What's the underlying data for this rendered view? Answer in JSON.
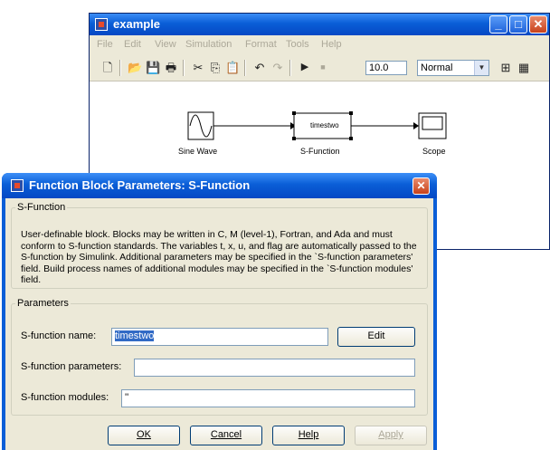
{
  "model_window": {
    "title": "example",
    "menu": [
      "File",
      "Edit",
      "View",
      "Simulation",
      "Format",
      "Tools",
      "Help"
    ],
    "stop_time": "10.0",
    "sim_mode": "Normal",
    "blocks": [
      {
        "name": "Sine Wave"
      },
      {
        "name": "S-Function",
        "content": "timestwo"
      },
      {
        "name": "Scope"
      }
    ]
  },
  "dialog": {
    "title": "Function Block Parameters: S-Function",
    "section_label": "S-Function",
    "description": "User-definable block.  Blocks may be written in C, M (level-1), Fortran, and Ada and must conform to S-function standards.  The variables t, x, u, and flag are automatically passed to the S-function by Simulink.  Additional parameters may be specified in the `S-function parameters' field. Build process names of additional modules may be specified in the `S-function modules' field.",
    "params_label": "Parameters",
    "name_label": "S-function name:",
    "name_value": "timestwo",
    "edit_label": "Edit",
    "params_field_label": "S-function parameters:",
    "params_value": "",
    "modules_label": "S-function modules:",
    "modules_value": "''",
    "buttons": {
      "ok": "OK",
      "cancel": "Cancel",
      "help": "Help",
      "apply": "Apply"
    }
  }
}
